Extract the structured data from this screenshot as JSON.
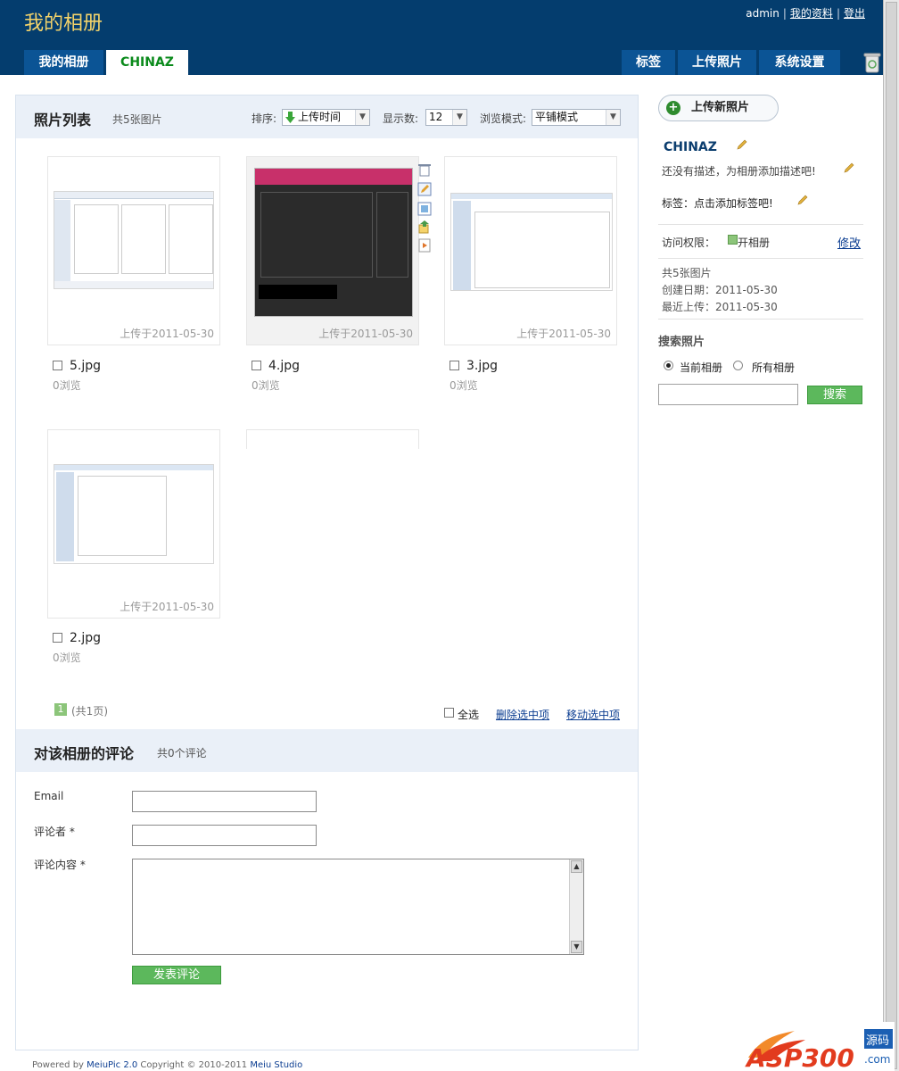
{
  "header": {
    "title": "我的相册",
    "user": "admin",
    "profile_link": "我的资料",
    "logout_link": "登出",
    "tabs_left": [
      "我的相册",
      "CHINAZ"
    ],
    "tabs_right": [
      "标签",
      "上传照片",
      "系统设置"
    ]
  },
  "photos_panel": {
    "title": "照片列表",
    "count": "共5张图片",
    "sort_label": "排序:",
    "sort_value": "上传时间",
    "show_label": "显示数:",
    "show_value": "12",
    "view_label": "浏览模式:",
    "view_value": "平铺模式"
  },
  "photos": [
    {
      "name": "5.jpg",
      "date": "上传于2011-05-30",
      "views": "0浏览"
    },
    {
      "name": "4.jpg",
      "date": "上传于2011-05-30",
      "views": "0浏览"
    },
    {
      "name": "3.jpg",
      "date": "上传于2011-05-30",
      "views": "0浏览"
    },
    {
      "name": "2.jpg",
      "date": "上传于2011-05-30",
      "views": "0浏览"
    }
  ],
  "pager": {
    "current": "1",
    "total_text": "(共1页)"
  },
  "bulk": {
    "select_all": "全选",
    "delete_selected": "删除选中项",
    "move_selected": "移动选中项"
  },
  "comments": {
    "title": "对该相册的评论",
    "count": "共0个评论",
    "email_label": "Email",
    "author_label": "评论者 *",
    "content_label": "评论内容 *",
    "submit": "发表评论"
  },
  "sidebar": {
    "upload_button": "上传新照片",
    "album_name": "CHINAZ",
    "description_prompt": "还没有描述，为相册添加描述吧!",
    "tags_prompt": "标签：点击添加标签吧!",
    "access_label": "访问权限：",
    "access_value": "开相册",
    "access_edit": "修改",
    "photo_count": "共5张图片",
    "created": "创建日期：2011-05-30",
    "last_upload": "最近上传：2011-05-30",
    "search_title": "搜索照片",
    "radio_current": "当前相册",
    "radio_all": "所有相册",
    "search_button": "搜索"
  },
  "footer": {
    "powered": "Powered by",
    "product": "MeiuPic 2.0",
    "copyright": "Copyright © 2010-2011",
    "studio": "Meiu Studio"
  },
  "colors": {
    "header_bg": "#043d6e",
    "tab_bg": "#0b5495",
    "active_tab_text": "#0a8a1b",
    "title_yellow": "#f3d36a",
    "panel_bg": "#eaf0f8",
    "green": "#5cb85c"
  }
}
